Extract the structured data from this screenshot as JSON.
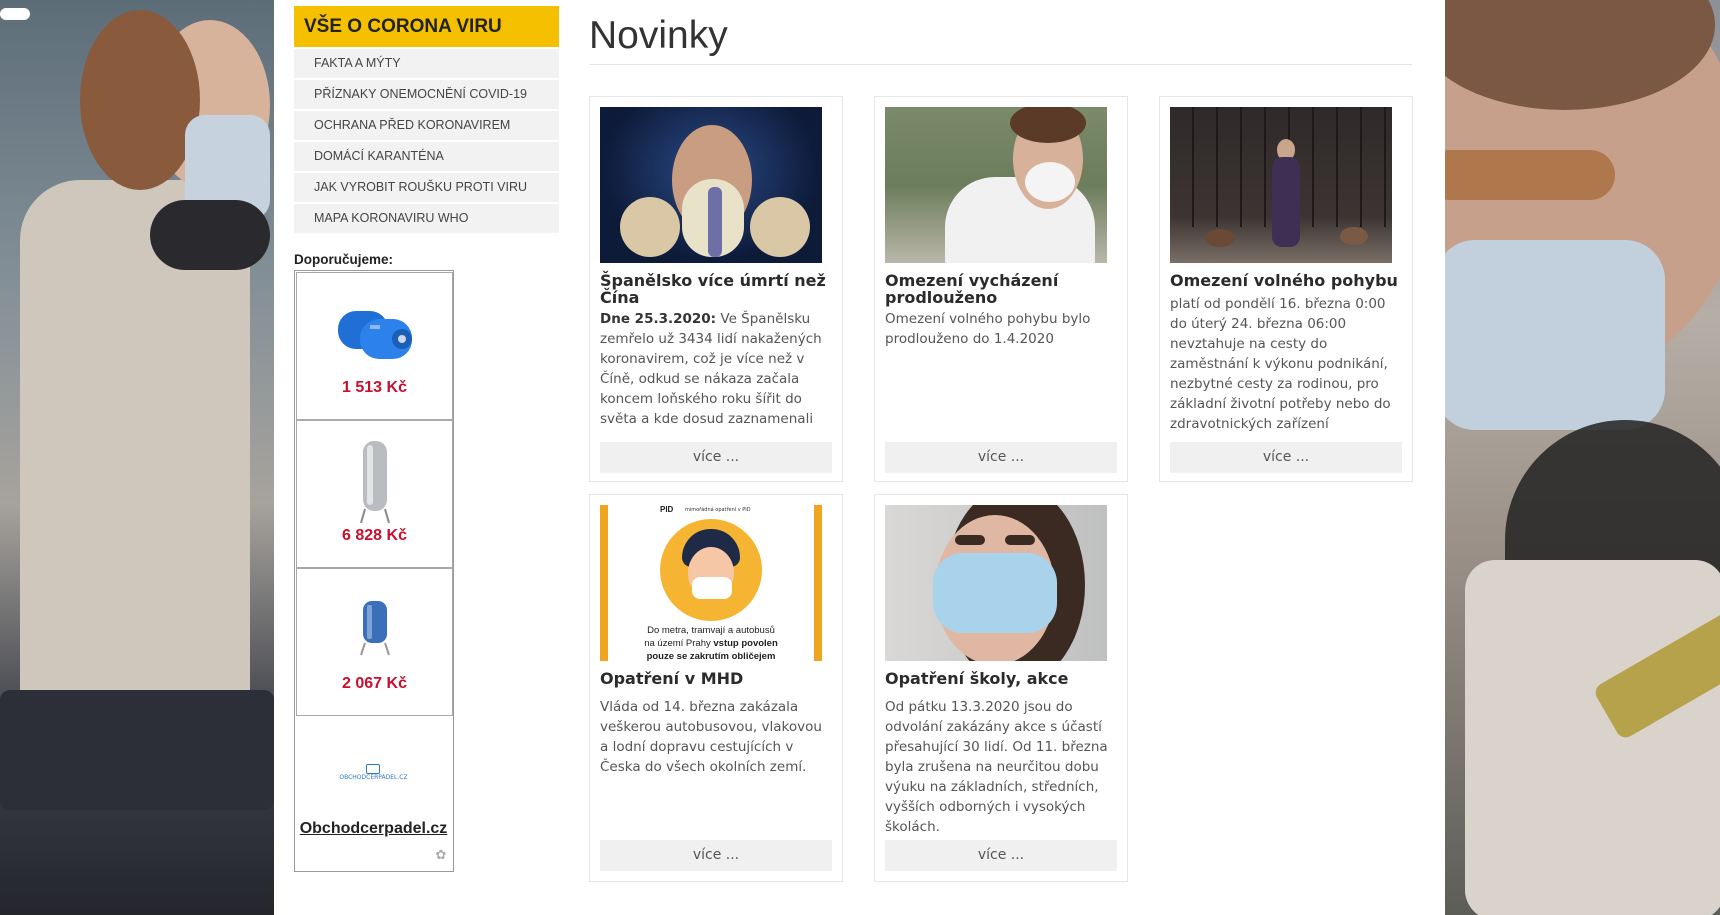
{
  "sidebar": {
    "menu_title": "VŠE O CORONA VIRU",
    "items": [
      {
        "label": "FAKTA A MÝTY"
      },
      {
        "label": "PŘÍZNAKY ONEMOCNĚNÍ COVID-19"
      },
      {
        "label": "OCHRANA PŘED KORONAVIREM"
      },
      {
        "label": "DOMÁCÍ KARANTÉNA"
      },
      {
        "label": "JAK VYROBIT ROUŠKU PROTI VIRU"
      },
      {
        "label": "MAPA KORONAVIRU WHO"
      }
    ],
    "recommend_label": "Doporučujeme:",
    "ads": [
      {
        "price": "1 513 Kč",
        "icon": "blue-pressure-tank-icon"
      },
      {
        "price": "6 828 Kč",
        "icon": "steel-tank-icon"
      },
      {
        "price": "2 067 Kč",
        "icon": "blue-vessel-icon"
      }
    ],
    "ad_logo_text": "OBCHODCERPADEL.CZ",
    "ad_brand": "Obchodcerpadel.cz"
  },
  "main": {
    "title": "Novinky",
    "more_label": "více ...",
    "cards": [
      {
        "title": "Španělsko více úmrtí než Čína",
        "lead": "Dne 25.3.2020:",
        "text": " Ve Španělsku zemřelo už 3434 lidí nakažených koronavirem, což je více než v Číně, odkud se nákaza začala koncem loňského roku šířit do světa a kde dosud zaznamenali"
      },
      {
        "title": "Omezení vycházení prodlouženo",
        "lead": "",
        "text": "Omezení volného pohybu bylo prodlouženo do 1.4.2020"
      },
      {
        "title": "Omezení volného pohybu",
        "lead": "",
        "text": "platí od pondělí 16. března 0:00 do úterý 24. března 06:00 nevztahuje na cesty do zaměstnání k výkonu podnikání, nezbytné cesty za rodinou, pro základní životní potřeby nebo do zdravotnických zařízení"
      },
      {
        "title": "Opatření v MHD",
        "lead": "",
        "text": "Vláda od 14. března zakázala veškerou autobusovou, vlakovou a lodní dopravu cestujících v Česka do všech okolních zemí.",
        "image_text": {
          "top": "mimořádná opatření v PID",
          "line1": "Do metra, tramvají a autobusů",
          "line2a": "na území Prahy ",
          "line2b": "vstup povolen",
          "line3": "pouze se zakrutím obličejem"
        }
      },
      {
        "title": "Opatření školy, akce",
        "lead": "",
        "text": "Od pátku 13.3.2020 jsou do odvolání zakázány akce s účastí přesahující 30 lidí. Od 11. března byla zrušena na neurčitou dobu výuku na základních, středních, vyšších odborných i vysokých školách."
      }
    ]
  }
}
